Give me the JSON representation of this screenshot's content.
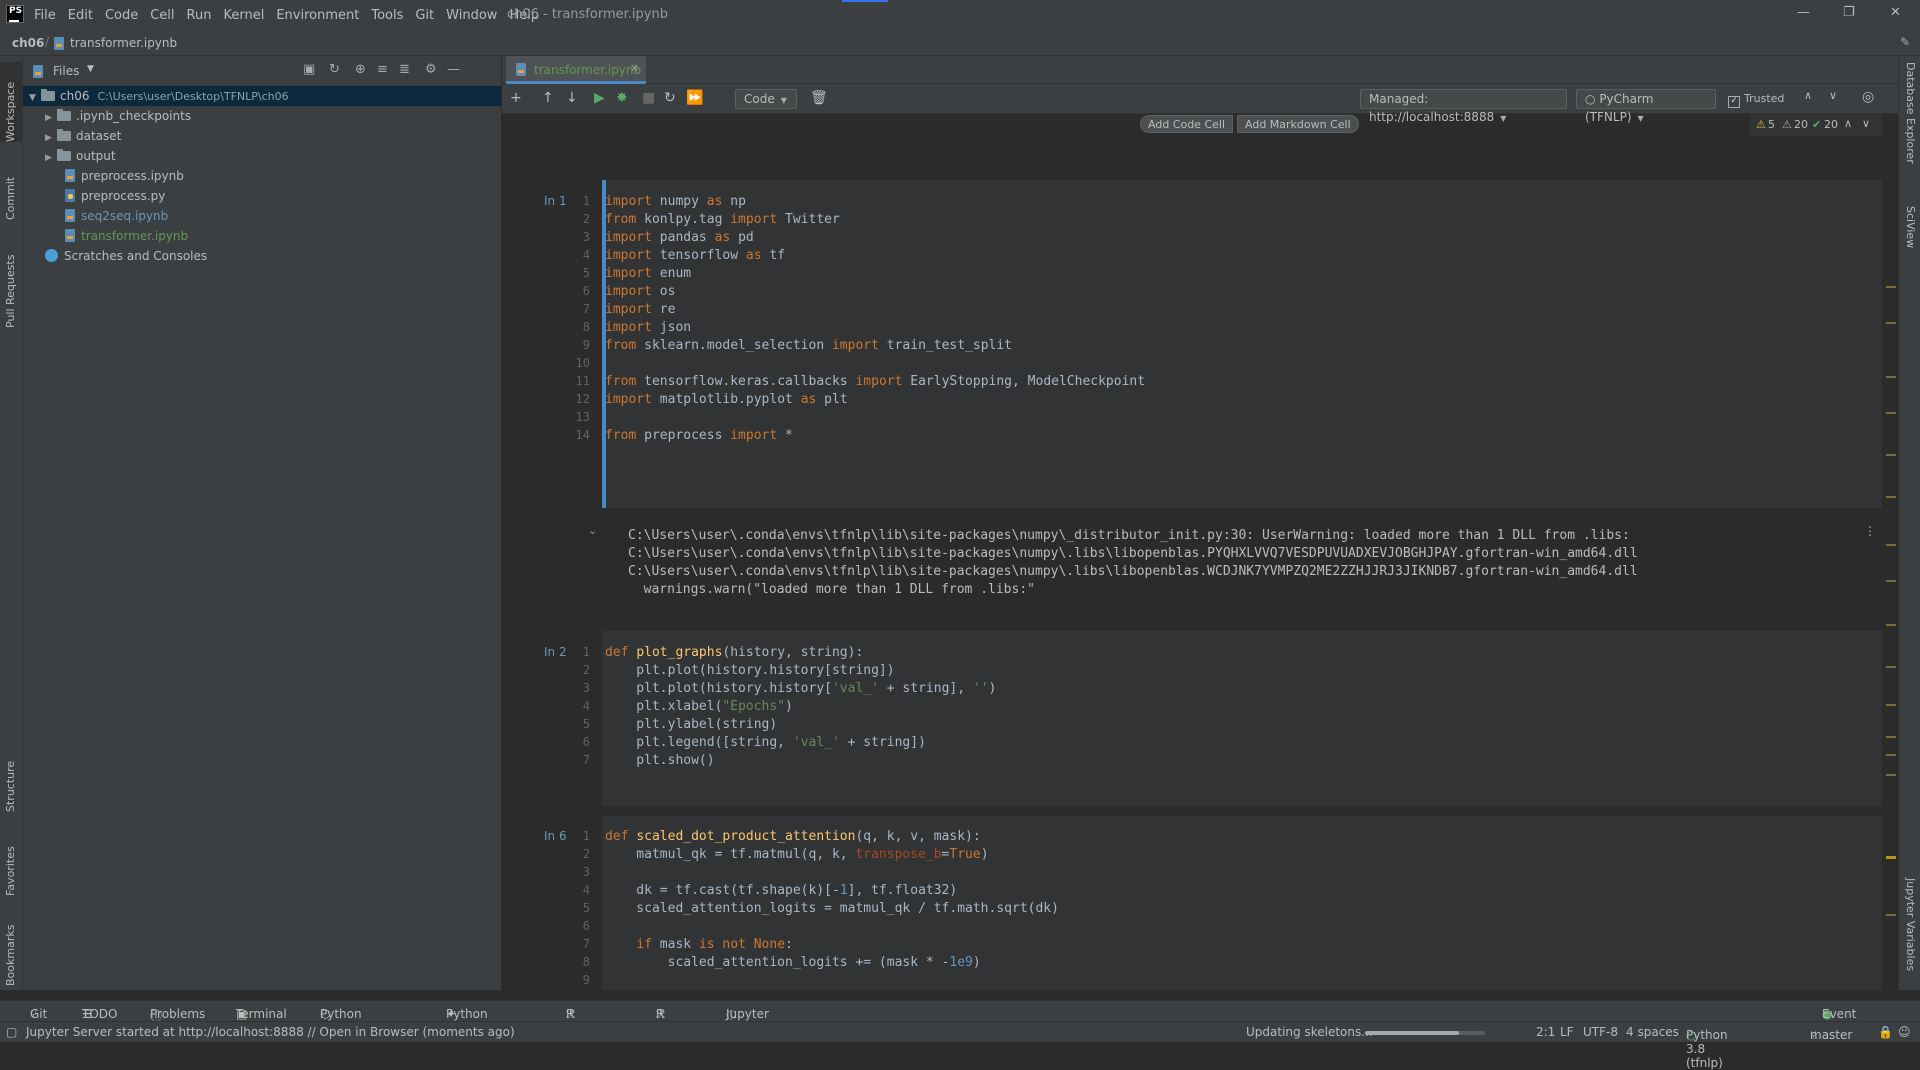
{
  "window": {
    "title": "ch06 - transformer.ipynb",
    "menu": [
      "File",
      "Edit",
      "Code",
      "Cell",
      "Run",
      "Kernel",
      "Environment",
      "Tools",
      "Git",
      "Window",
      "Help"
    ]
  },
  "nav": {
    "project": "ch06",
    "file": "transformer.ipynb"
  },
  "left_tabs": [
    "Workspace",
    "Commit",
    "Pull Requests",
    "Structure",
    "Favorites",
    "Bookmarks"
  ],
  "right_tabs": [
    "Database Explorer",
    "SciView",
    "Jupyter Variables"
  ],
  "project_panel": {
    "title": "Files",
    "root": {
      "name": "ch06",
      "path": "C:\\Users\\user\\Desktop\\TFNLP\\ch06"
    },
    "items": [
      {
        "name": ".ipynb_checkpoints",
        "type": "folder"
      },
      {
        "name": "dataset",
        "type": "folder"
      },
      {
        "name": "output",
        "type": "folder"
      },
      {
        "name": "preprocess.ipynb",
        "type": "notebook"
      },
      {
        "name": "preprocess.py",
        "type": "python"
      },
      {
        "name": "seq2seq.ipynb",
        "type": "notebook"
      },
      {
        "name": "transformer.ipynb",
        "type": "notebook"
      }
    ],
    "scratches": "Scratches and Consoles"
  },
  "editor": {
    "tab": "transformer.ipynb",
    "cell_type": "Code",
    "server": "Managed: http://localhost:8888",
    "kernel": "PyCharm (TFNLP)",
    "trusted": "Trusted",
    "add_code_cell": "Add Code Cell",
    "add_markdown_cell": "Add Markdown Cell",
    "inspections": {
      "warnings": "5",
      "weak_warnings": "20",
      "ok": "20"
    }
  },
  "cells": [
    {
      "label": "In 1",
      "lines": [
        "import numpy as np",
        "from konlpy.tag import Twitter",
        "import pandas as pd",
        "import tensorflow as tf",
        "import enum",
        "import os",
        "import re",
        "import json",
        "from sklearn.model_selection import train_test_split",
        "",
        "from tensorflow.keras.callbacks import EarlyStopping, ModelCheckpoint",
        "import matplotlib.pyplot as plt",
        "",
        "from preprocess import *"
      ],
      "output": [
        "C:\\Users\\user\\.conda\\envs\\tfnlp\\lib\\site-packages\\numpy\\_distributor_init.py:30: UserWarning: loaded more than 1 DLL from .libs:",
        "C:\\Users\\user\\.conda\\envs\\tfnlp\\lib\\site-packages\\numpy\\.libs\\libopenblas.PYQHXLVVQ7VESDPUVUADXEVJOBGHJPAY.gfortran-win_amd64.dll",
        "C:\\Users\\user\\.conda\\envs\\tfnlp\\lib\\site-packages\\numpy\\.libs\\libopenblas.WCDJNK7YVMPZQ2ME2ZZHJJRJ3JIKNDB7.gfortran-win_amd64.dll",
        "  warnings.warn(\"loaded more than 1 DLL from .libs:\""
      ]
    },
    {
      "label": "In 2",
      "lines": [
        "def plot_graphs(history, string):",
        "    plt.plot(history.history[string])",
        "    plt.plot(history.history['val_' + string], '')",
        "    plt.xlabel(\"Epochs\")",
        "    plt.ylabel(string)",
        "    plt.legend([string, 'val_' + string])",
        "    plt.show()"
      ]
    },
    {
      "label": "In 6",
      "lines": [
        "def scaled_dot_product_attention(q, k, v, mask):",
        "    matmul_qk = tf.matmul(q, k, transpose_b=True)",
        "",
        "    dk = tf.cast(tf.shape(k)[-1], tf.float32)",
        "    scaled_attention_logits = matmul_qk / tf.math.sqrt(dk)",
        "",
        "    if mask is not None:",
        "        scaled_attention_logits += (mask * -1e9)",
        ""
      ]
    }
  ],
  "bottom_tools": [
    "Git",
    "TODO",
    "Problems",
    "Terminal",
    "Python Packages",
    "Python Console",
    "R Console",
    "R Jobs",
    "Jupyter"
  ],
  "event_log": "Event Log",
  "status": {
    "message": "Jupyter Server started at http://localhost:8888 // Open in Browser (moments ago)",
    "progress_label": "Updating skeletons...",
    "progress": 0.78,
    "position": "2:1",
    "line_sep": "LF",
    "encoding": "UTF-8",
    "indent": "4 spaces",
    "interpreter": "Python 3.8 (tfnlp)",
    "branch": "master"
  }
}
